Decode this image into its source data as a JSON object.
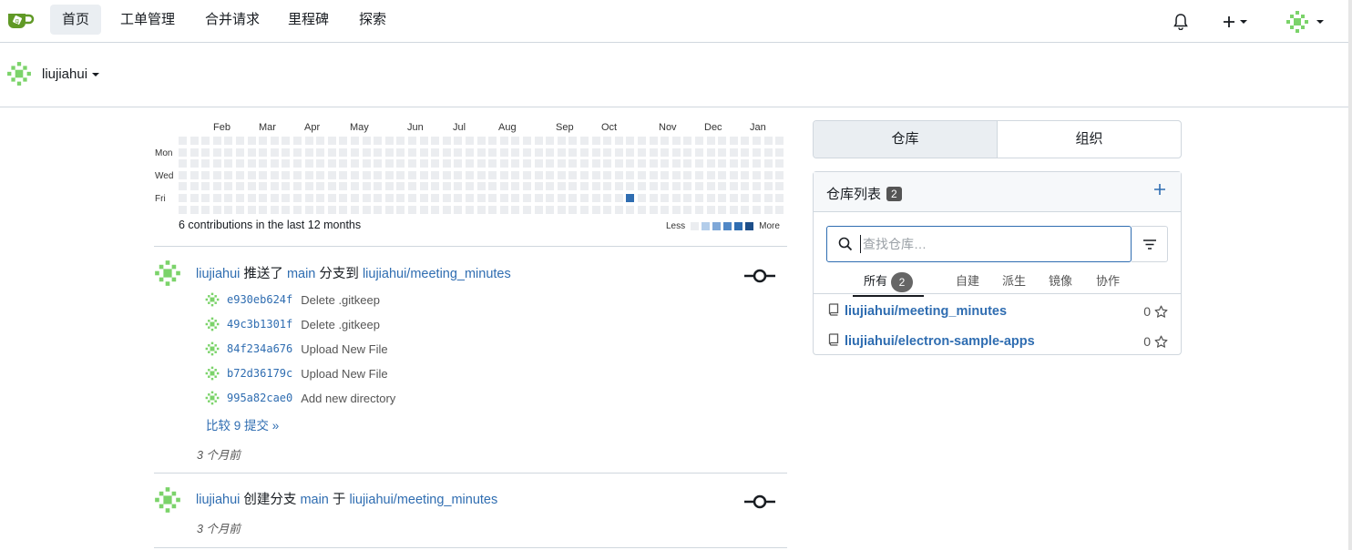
{
  "nav": {
    "items": [
      "首页",
      "工单管理",
      "合并请求",
      "里程碑",
      "探索"
    ],
    "icons": {
      "notifications": "bell-icon",
      "create": "plus-icon",
      "avatar": "user-avatar"
    }
  },
  "user": {
    "name": "liujiahui"
  },
  "heatmap": {
    "months": [
      "Feb",
      "Mar",
      "Apr",
      "May",
      "Jun",
      "Jul",
      "Aug",
      "Sep",
      "Oct",
      "Nov",
      "Dec",
      "Jan"
    ],
    "days": [
      "Mon",
      "Wed",
      "Fri"
    ],
    "summary": "6 contributions in the last 12 months",
    "legend_less": "Less",
    "legend_more": "More",
    "colors": {
      "empty": "#ebedf0",
      "levels": [
        "#b3cdea",
        "#7fa8d8",
        "#4f87c6",
        "#2f6db1",
        "#1d4e89"
      ]
    }
  },
  "feed": [
    {
      "user": "liujiahui",
      "action": "推送了",
      "branch": "main",
      "mid": "分支到",
      "repo": "liujiahui/meeting_minutes",
      "commits": [
        {
          "sha": "e930eb624f",
          "message": "Delete .gitkeep"
        },
        {
          "sha": "49c3b1301f",
          "message": "Delete .gitkeep"
        },
        {
          "sha": "84f234a676",
          "message": "Upload New File"
        },
        {
          "sha": "b72d36179c",
          "message": "Upload New File"
        },
        {
          "sha": "995a82cae0",
          "message": "Add new directory"
        }
      ],
      "compare": "比较 9 提交 »",
      "time": "3 个月前"
    },
    {
      "user": "liujiahui",
      "action": "创建分支",
      "branch": "main",
      "mid": "于",
      "repo": "liujiahui/meeting_minutes",
      "time": "3 个月前"
    }
  ],
  "side": {
    "tabs": [
      "仓库",
      "组织"
    ],
    "repo_list_title": "仓库列表",
    "repo_count": "2",
    "search_placeholder": "查找仓库…",
    "filters": [
      "所有",
      "自建",
      "派生",
      "镜像",
      "协作"
    ],
    "all_count": "2",
    "repos": [
      {
        "name": "liujiahui/meeting_minutes",
        "stars": "0"
      },
      {
        "name": "liujiahui/electron-sample-apps",
        "stars": "0"
      }
    ]
  }
}
